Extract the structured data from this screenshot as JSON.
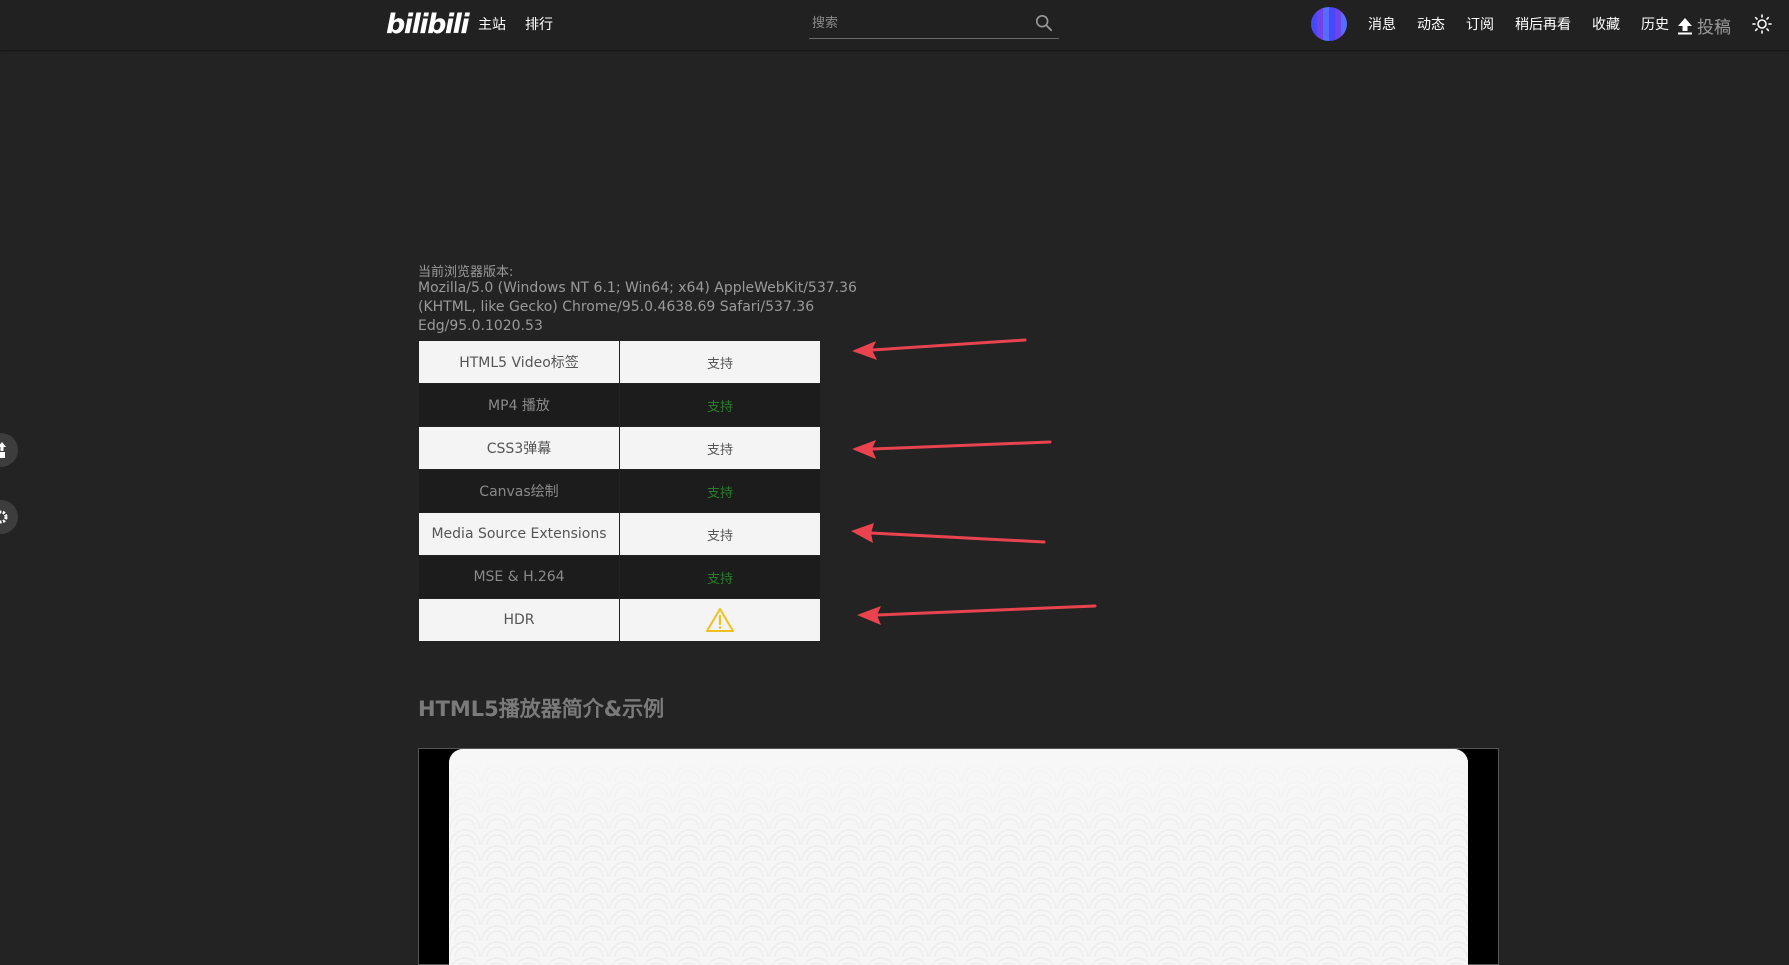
{
  "header": {
    "logo": "bilibili",
    "nav_left": [
      "主站",
      "排行"
    ],
    "search_placeholder": "搜索",
    "nav_right": [
      "消息",
      "动态",
      "订阅",
      "稍后再看",
      "收藏",
      "历史"
    ],
    "upload_label": "投稿"
  },
  "browser_info": {
    "label": "当前浏览器版本:",
    "user_agent": "Mozilla/5.0 (Windows NT 6.1; Win64; x64) AppleWebKit/537.36 (KHTML, like Gecko) Chrome/95.0.4638.69 Safari/537.36 Edg/95.0.1020.53"
  },
  "support_table": {
    "rows": [
      {
        "feature": "HTML5 Video标签",
        "status": "支持",
        "annotated": true
      },
      {
        "feature": "MP4 播放",
        "status": "支持",
        "annotated": false
      },
      {
        "feature": "CSS3弹幕",
        "status": "支持",
        "annotated": true
      },
      {
        "feature": "Canvas绘制",
        "status": "支持",
        "annotated": false
      },
      {
        "feature": "Media Source Extensions",
        "status": "支持",
        "annotated": true
      },
      {
        "feature": "MSE & H.264",
        "status": "支持",
        "annotated": false
      },
      {
        "feature": "HDR",
        "status_icon": "warning-icon",
        "annotated": true
      }
    ]
  },
  "section": {
    "title": "HTML5播放器简介&示例"
  },
  "colors": {
    "background": "#232323",
    "supported": "#2b9c2b",
    "warning": "#f0c020",
    "annotation_arrow": "#e8434f"
  }
}
